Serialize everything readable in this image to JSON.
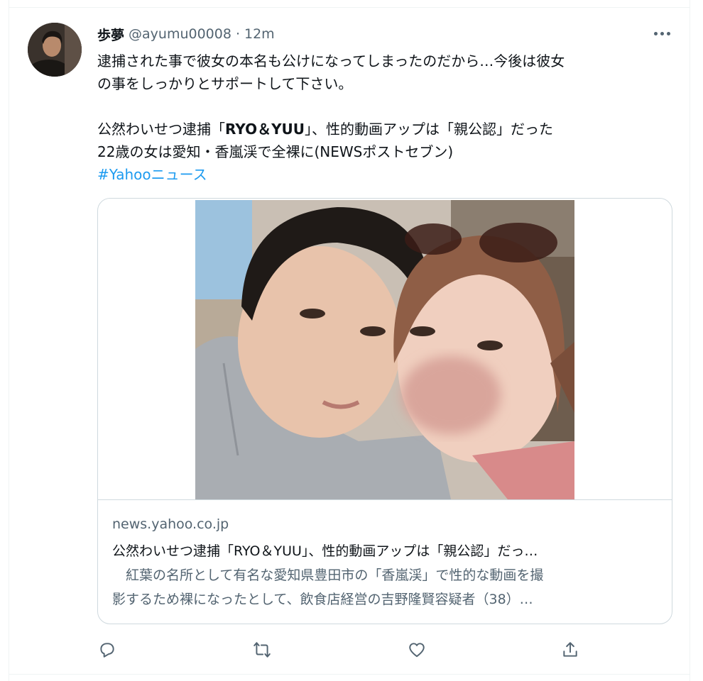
{
  "tweet": {
    "author_name": "歩夢",
    "author_handle": "@ayumu00008",
    "separator": "·",
    "time": "12m",
    "text_lines": [
      "逮捕された事で彼女の本名も公けになってしまったのだから…今後は彼女",
      "の事をしっかりとサポートして下さい。"
    ],
    "headline_line1_a": "公然わいせつ逮捕「",
    "headline_line1_bold": "RYO＆YUU",
    "headline_line1_b": "」、性的動画アップは「親公認」だった",
    "headline_line2": "22歳の女は愛知・香嵐渓で全裸に(NEWSポストセブン)",
    "hashtag": "#Yahooニュース"
  },
  "card": {
    "domain": "news.yahoo.co.jp",
    "title": "公然わいせつ逮捕「RYO＆YUU」、性的動画アップは「親公認」だっ…",
    "description_lines": [
      "　紅葉の名所として有名な愛知県豊田市の「香嵐渓」で性的な動画を撮",
      "影するため裸になったとして、飲食店経営の吉野隆賢容疑者（38）…"
    ]
  },
  "actions": {
    "reply": "reply-icon",
    "retweet": "retweet-icon",
    "like": "heart-icon",
    "share": "share-icon"
  },
  "colors": {
    "link": "#1d9bf0",
    "secondary_text": "#536471",
    "border": "#cfd9de"
  }
}
